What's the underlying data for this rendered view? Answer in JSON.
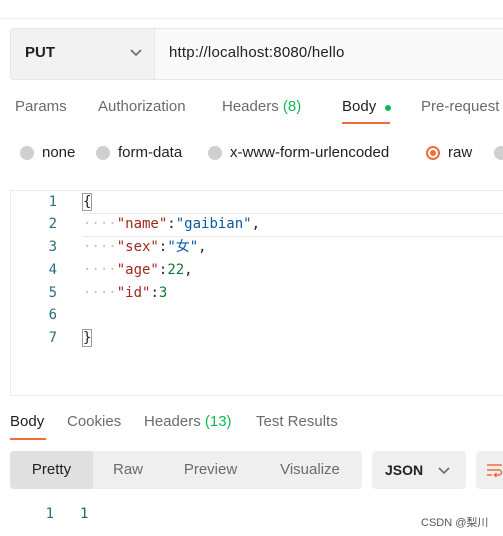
{
  "request": {
    "method": "PUT",
    "url": "http://localhost:8080/hello"
  },
  "request_tabs": [
    {
      "label": "Params"
    },
    {
      "label": "Authorization"
    },
    {
      "label": "Headers",
      "count": "(8)"
    },
    {
      "label": "Body",
      "active": true
    },
    {
      "label": "Pre-request"
    }
  ],
  "body_types": [
    "none",
    "form-data",
    "x-www-form-urlencoded",
    "raw"
  ],
  "body_selected": "raw",
  "editor": {
    "line_numbers": [
      "1",
      "2",
      "3",
      "4",
      "5",
      "6",
      "7"
    ],
    "lines": [
      {
        "brace": "{"
      },
      {
        "key": "\"name\"",
        "value": "\"gaibian\"",
        "suffix": ","
      },
      {
        "key": "\"sex\"",
        "value": "\"女\"",
        "suffix": ","
      },
      {
        "key": "\"age\"",
        "value": "22",
        "suffix": ","
      },
      {
        "key": "\"id\"",
        "value": "3",
        "suffix": ""
      },
      {
        "text": ""
      },
      {
        "brace": "}"
      }
    ]
  },
  "response_tabs": [
    {
      "label": "Body",
      "active": true
    },
    {
      "label": "Cookies"
    },
    {
      "label": "Headers",
      "count": "(13)"
    },
    {
      "label": "Test Results"
    }
  ],
  "view_modes": [
    "Pretty",
    "Raw",
    "Preview",
    "Visualize"
  ],
  "view_active": "Pretty",
  "format": "JSON",
  "response": {
    "line_number": "1",
    "value": "1"
  },
  "watermark": "CSDN @梨川",
  "colors": {
    "accent": "#f26b3a",
    "count_green": "#0cbb52"
  }
}
